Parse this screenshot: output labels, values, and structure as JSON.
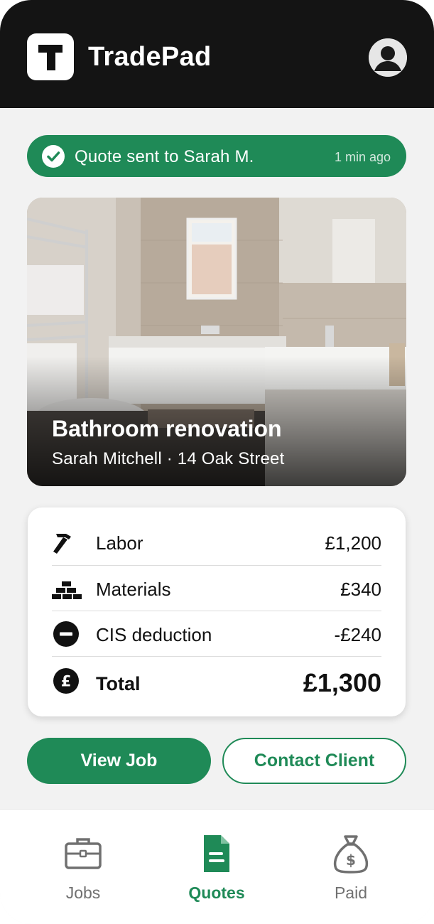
{
  "header": {
    "app_name": "TradePad"
  },
  "toast": {
    "message": "Quote sent to Sarah M.",
    "time": "1 min ago"
  },
  "job": {
    "title": "Bathroom renovation",
    "subtitle": "Sarah Mitchell · 14 Oak Street"
  },
  "breakdown": [
    {
      "icon": "hammer-icon",
      "label": "Labor",
      "amount": "£1,200"
    },
    {
      "icon": "bricks-icon",
      "label": "Materials",
      "amount": "£340"
    },
    {
      "icon": "minus-circle-icon",
      "label": "CIS deduction",
      "amount": "-£240"
    }
  ],
  "total": {
    "icon": "pound-circle-icon",
    "label": "Total",
    "amount": "£1,300"
  },
  "actions": {
    "primary": "View Job",
    "secondary": "Contact Client"
  },
  "nav": [
    {
      "icon": "briefcase-icon",
      "label": "Jobs",
      "active": false
    },
    {
      "icon": "document-icon",
      "label": "Quotes",
      "active": true
    },
    {
      "icon": "money-bag-icon",
      "label": "Paid",
      "active": false
    }
  ],
  "colors": {
    "accent": "#1f8a57",
    "header_bg": "#141414",
    "background": "#f2f2f2"
  }
}
